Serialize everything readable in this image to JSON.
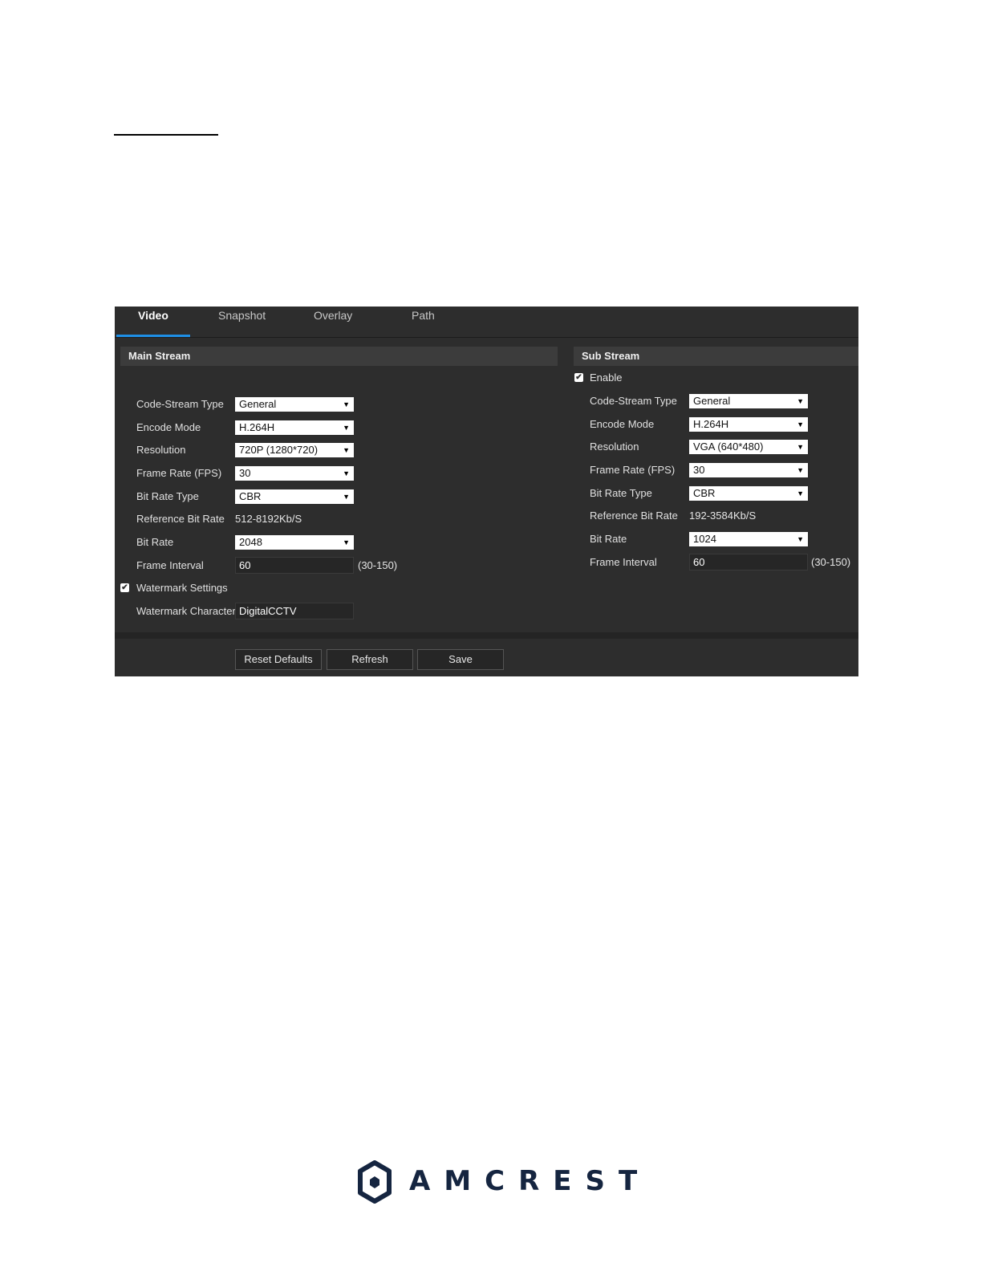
{
  "tabs": [
    {
      "label": "Video",
      "active": true
    },
    {
      "label": "Snapshot",
      "active": false
    },
    {
      "label": "Overlay",
      "active": false
    },
    {
      "label": "Path",
      "active": false
    }
  ],
  "main_stream": {
    "title": "Main Stream",
    "labels": {
      "code_stream_type": "Code-Stream Type",
      "encode_mode": "Encode Mode",
      "resolution": "Resolution",
      "frame_rate": "Frame Rate (FPS)",
      "bit_rate_type": "Bit Rate Type",
      "reference_bit_rate": "Reference Bit Rate",
      "bit_rate": "Bit Rate",
      "frame_interval": "Frame Interval",
      "watermark_settings": "Watermark Settings",
      "watermark_character": "Watermark Character"
    },
    "values": {
      "code_stream_type": "General",
      "encode_mode": "H.264H",
      "resolution": "720P (1280*720)",
      "frame_rate": "30",
      "bit_rate_type": "CBR",
      "reference_bit_rate": "512-8192Kb/S",
      "bit_rate": "2048",
      "frame_interval": "60",
      "frame_interval_range": "(30-150)",
      "watermark_checked": true,
      "watermark_character": "DigitalCCTV"
    }
  },
  "sub_stream": {
    "title": "Sub Stream",
    "enable_label": "Enable",
    "enable_checked": true,
    "labels": {
      "code_stream_type": "Code-Stream Type",
      "encode_mode": "Encode Mode",
      "resolution": "Resolution",
      "frame_rate": "Frame Rate (FPS)",
      "bit_rate_type": "Bit Rate Type",
      "reference_bit_rate": "Reference Bit Rate",
      "bit_rate": "Bit Rate",
      "frame_interval": "Frame Interval"
    },
    "values": {
      "code_stream_type": "General",
      "encode_mode": "H.264H",
      "resolution": "VGA (640*480)",
      "frame_rate": "30",
      "bit_rate_type": "CBR",
      "reference_bit_rate": "192-3584Kb/S",
      "bit_rate": "1024",
      "frame_interval": "60",
      "frame_interval_range": "(30-150)"
    }
  },
  "buttons": {
    "reset_defaults": "Reset Defaults",
    "refresh": "Refresh",
    "save": "Save"
  },
  "glyphs": {
    "dropdown_arrow": "▼",
    "check": "✔"
  },
  "logo": {
    "text": "AMCREST",
    "color": "#152540"
  },
  "colors": {
    "panel_bg": "#2d2d2d",
    "tab_accent": "#1e8fe6"
  }
}
